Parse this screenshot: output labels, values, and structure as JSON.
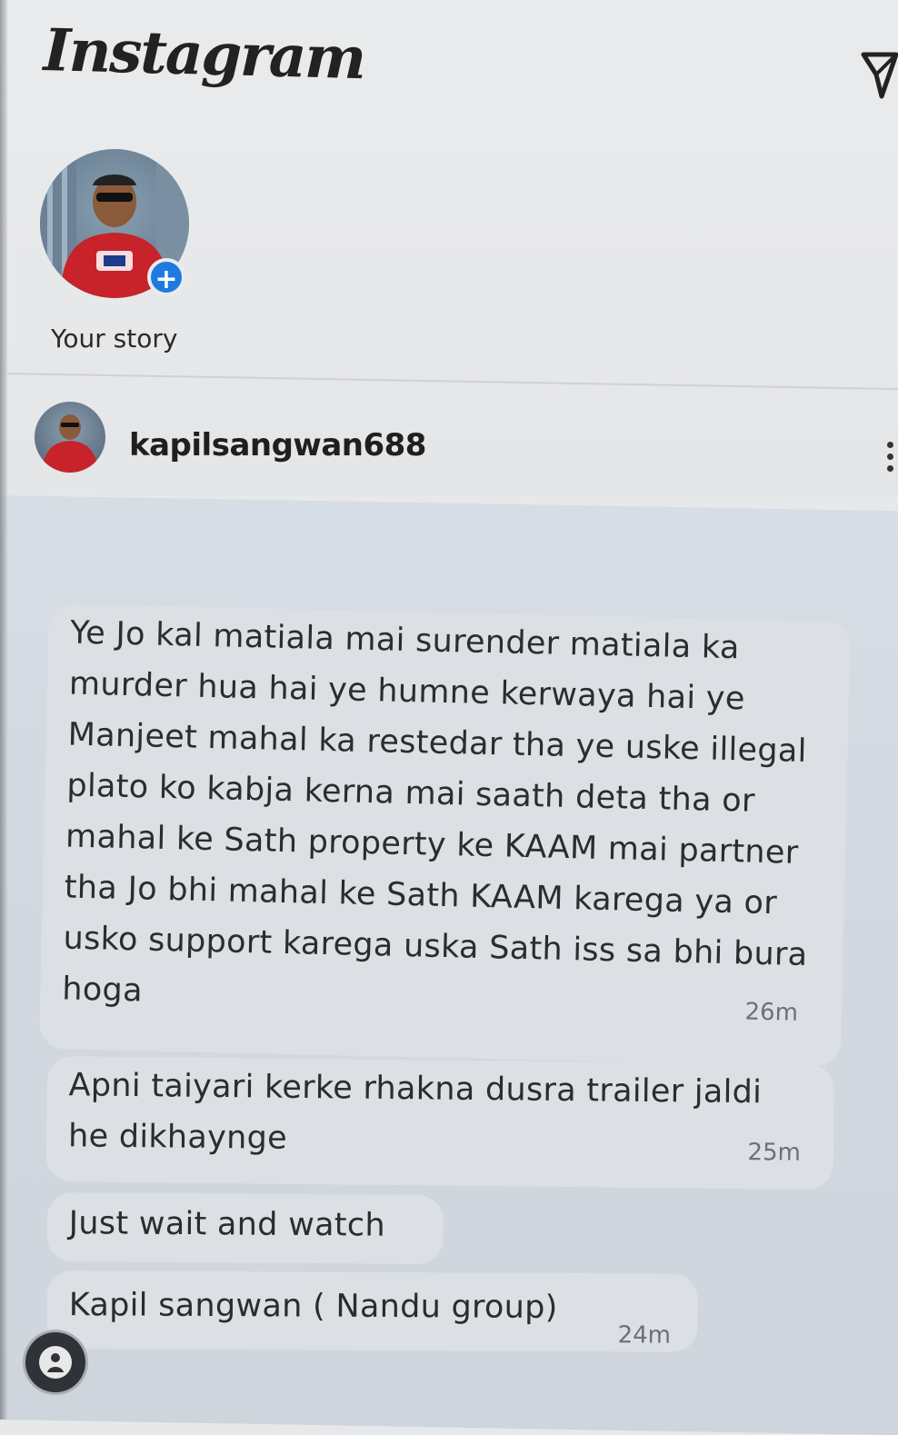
{
  "header": {
    "app_title": "Instagram",
    "send_icon": "paper-plane-icon"
  },
  "story": {
    "label": "Your story",
    "add_icon": "plus-icon",
    "accent_color": "#1f7ae0"
  },
  "chat": {
    "username": "kapilsangwan688",
    "more_icon": "more-vertical-icon",
    "messages": [
      {
        "text": "Ye Jo kal matiala mai surender matiala ka murder hua hai ye humne kerwaya hai ye Manjeet mahal ka restedar tha ye uske illegal plato ko kabja kerna mai saath deta tha or mahal ke Sath property ke KAAM mai partner tha Jo bhi mahal ke Sath KAAM karega ya or usko support karega uska Sath iss sa bhi bura hoga",
        "time": "26m"
      },
      {
        "text": "Apni taiyari kerke rhakna dusra trailer jaldi he dikhaynge",
        "time": "25m"
      },
      {
        "text": "Just wait and watch",
        "time": ""
      },
      {
        "text": "Kapil sangwan ( Nandu group)",
        "time": "24m"
      }
    ]
  },
  "footer": {
    "icon": "chat-heads-icon"
  }
}
